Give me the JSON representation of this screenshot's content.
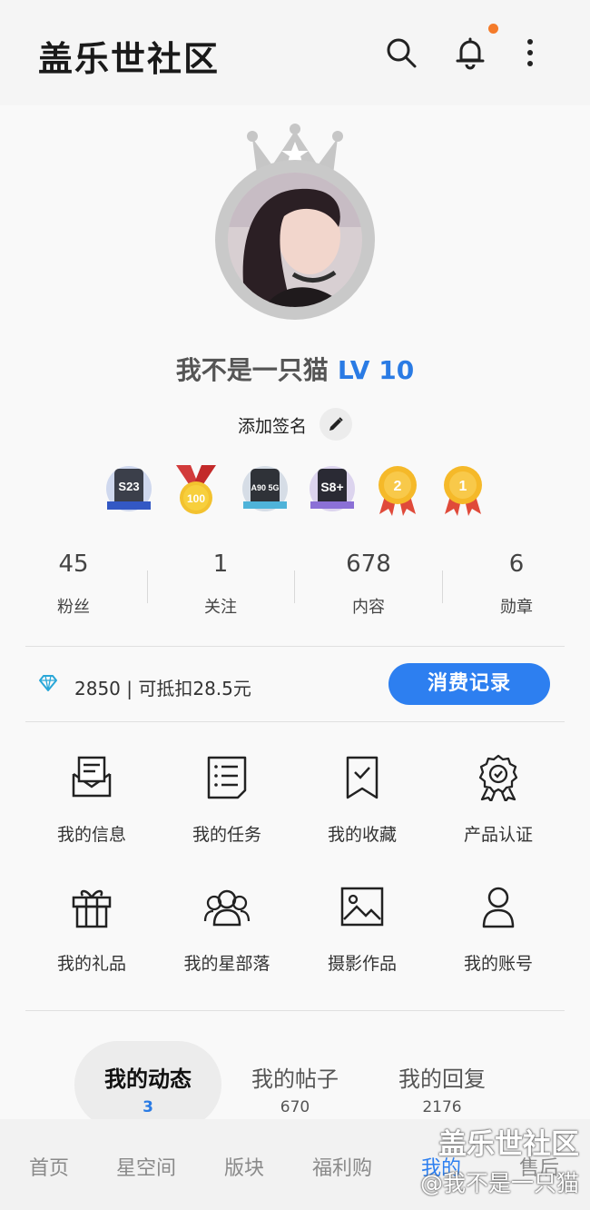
{
  "header": {
    "title": "盖乐世社区",
    "icons": [
      "search-icon",
      "bell-icon",
      "more-vertical-icon"
    ]
  },
  "profile": {
    "username": "我不是一只猫",
    "level": "LV 10",
    "signature_prompt": "添加签名",
    "badges": [
      {
        "name": "s23-badge",
        "text": "S23"
      },
      {
        "name": "medal-100-badge",
        "text": "100"
      },
      {
        "name": "a90-5g-badge",
        "text": "A90 5G"
      },
      {
        "name": "s8-plus-badge",
        "text": "S8+"
      },
      {
        "name": "anniversary-2-badge",
        "text": "2"
      },
      {
        "name": "anniversary-1-badge",
        "text": "1"
      }
    ],
    "stats": [
      {
        "value": "45",
        "label": "粉丝"
      },
      {
        "value": "1",
        "label": "关注"
      },
      {
        "value": "678",
        "label": "内容"
      },
      {
        "value": "6",
        "label": "勋章"
      }
    ],
    "points_text": "2850 | 可抵扣28.5元",
    "consume_button": "消费记录"
  },
  "menu": [
    {
      "label": "我的信息",
      "icon": "envelope-icon"
    },
    {
      "label": "我的任务",
      "icon": "task-list-icon"
    },
    {
      "label": "我的收藏",
      "icon": "bookmark-icon"
    },
    {
      "label": "产品认证",
      "icon": "certification-icon"
    },
    {
      "label": "我的礼品",
      "icon": "gift-icon"
    },
    {
      "label": "我的星部落",
      "icon": "group-icon"
    },
    {
      "label": "摄影作品",
      "icon": "image-icon"
    },
    {
      "label": "我的账号",
      "icon": "user-icon"
    }
  ],
  "content_tabs": [
    {
      "label": "我的动态",
      "count": "3"
    },
    {
      "label": "我的帖子",
      "count": "670"
    },
    {
      "label": "我的回复",
      "count": "2176"
    }
  ],
  "bottom_nav": [
    "首页",
    "星空间",
    "版块",
    "福利购",
    "我的",
    "售后"
  ],
  "watermark": {
    "line1": "盖乐世社区",
    "line2": "@我不是一只猫"
  },
  "colors": {
    "accent": "#2d7ff0",
    "level": "#2a7be4",
    "notification_dot": "#f47b2a"
  }
}
